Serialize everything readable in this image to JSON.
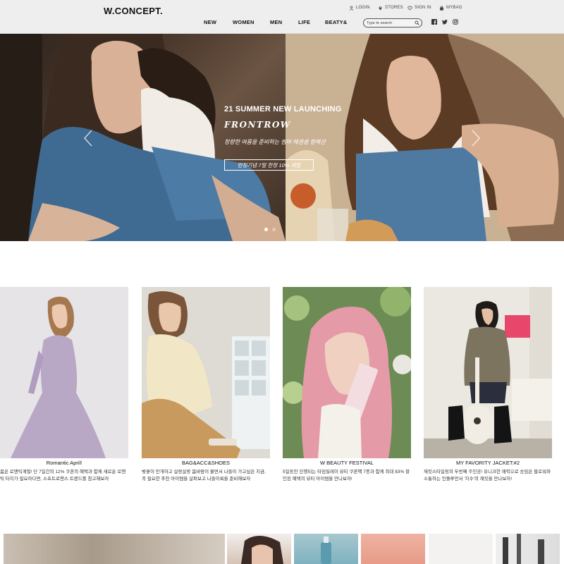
{
  "header": {
    "logo": "W.CONCEPT.",
    "util": {
      "login": "LOGIN",
      "stores": "STORES",
      "signin": "SIGN IN",
      "mybag": "MYBAG"
    },
    "nav": [
      "NEW",
      "WOMEN",
      "MEN",
      "LIFE",
      "BEATY&"
    ],
    "search": {
      "placeholder": "Type te search"
    },
    "social": [
      "facebook-icon",
      "twitter-icon",
      "instagram-icon"
    ]
  },
  "hero": {
    "title": "21 SUMMER NEW LAUNCHING",
    "brand": "FRONTROW",
    "subtitle": "청량한 여름을 준비하는 썸머 에센셜 컬렉션",
    "button": "런칭기념 7일 한정 10% 세일",
    "slides": 2,
    "active_slide": 1
  },
  "cards": [
    {
      "title": "Romantic April!",
      "desc": "봄은 로맨틱계절! 단 7일간의 12% 쿠폰의 혜택과 함께 새로운 로맨틱 타지가 필요하다면, 소프트로맨스 트렌드를 참고해보자"
    },
    {
      "title": "BAG&ACC&SHOES",
      "desc": "벚꽃이 만개하고 살랑살랑 봄바람이 불면서 나들이 가고싶은 지금, 꼭 필요한 추천 아이템을 살펴보고 나들이룩을 준비해보자"
    },
    {
      "title": "W BEAUTY FESTIVAL",
      "desc": "5일동안 진행되는 타임릴레이 뷰티 쿠폰팩 7종과 함께 최대 83% 할인된 혜택의 뷰티 아이템을 만나보자!"
    },
    {
      "title": "MY FAVORITY JACKET:#2",
      "desc": "재킷스타일링의 두번째 주인공! 유니크한 매력으로 승임은 팔로워와 소통하는 인플루언서 '지수'의 재킷을 만나보자!"
    }
  ],
  "colors": {
    "header_bg": "#eeeeee",
    "text": "#111111"
  }
}
